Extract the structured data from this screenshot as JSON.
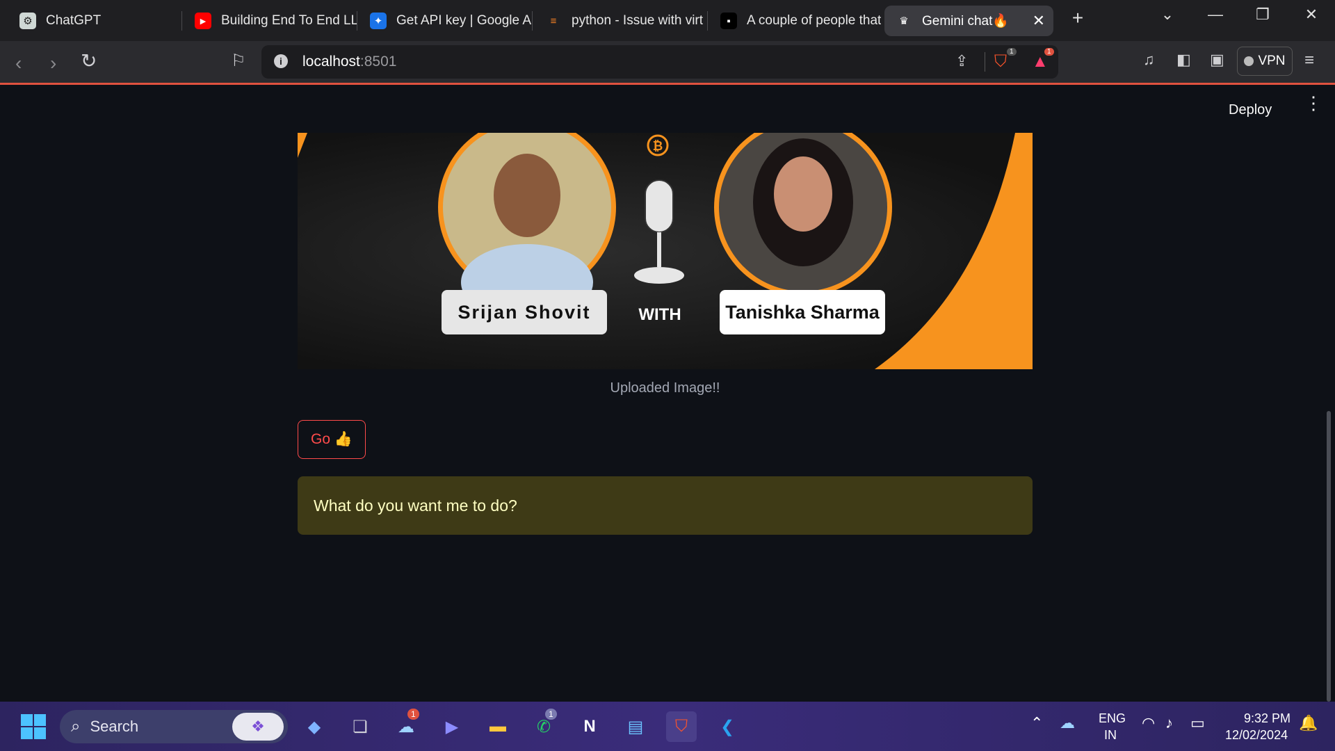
{
  "tabs": [
    {
      "title": "ChatGPT",
      "icon": "chatgpt-icon"
    },
    {
      "title": "Building End To End LLM",
      "icon": "youtube-icon"
    },
    {
      "title": "Get API key | Google AI",
      "icon": "google-ai-icon"
    },
    {
      "title": "python - Issue with virt",
      "icon": "stackoverflow-icon"
    },
    {
      "title": "A couple of people that",
      "icon": "page-icon"
    },
    {
      "title": "Gemini chat🔥",
      "icon": "streamlit-icon",
      "active": true
    }
  ],
  "toolbar": {
    "host": "localhost",
    "port": ":8501",
    "brave_badge": "1",
    "rewards_badge": "1",
    "vpn_label": "VPN"
  },
  "app": {
    "deploy_label": "Deploy",
    "banner": {
      "left_name": "Srijan Shovit",
      "right_name": "Tanishka Sharma",
      "with_label": "WITH"
    },
    "caption": "Uploaded Image!!",
    "go_button": "Go 👍",
    "alert_text": "What do you want me to do?"
  },
  "taskbar": {
    "search_placeholder": "Search",
    "weather_badge": "1",
    "whatsapp_badge": "1",
    "lang_top": "ENG",
    "lang_bottom": "IN",
    "time": "9:32 PM",
    "date": "12/02/2024"
  },
  "colors": {
    "accent": "#ff4b4b",
    "alert_bg": "#3e3a16",
    "banner_orange": "#f7931e"
  }
}
